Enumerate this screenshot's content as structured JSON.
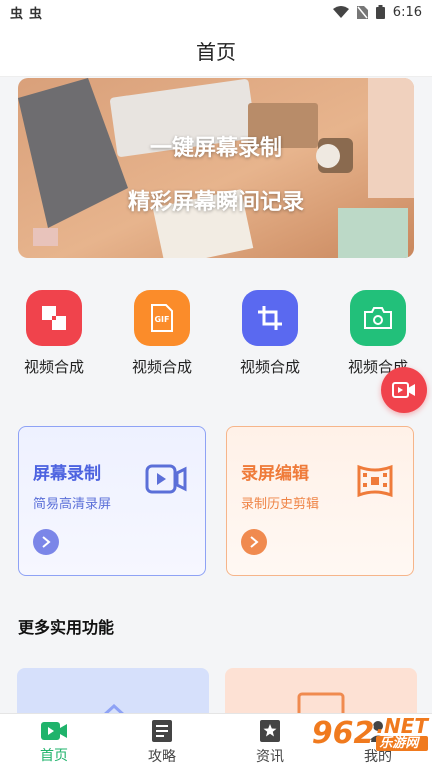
{
  "status": {
    "left_icons": [
      "虫",
      "虫"
    ],
    "time": "6:16"
  },
  "header": {
    "title": "首页"
  },
  "banner": {
    "line1": "一键屏幕录制",
    "line2": "精彩屏幕瞬间记录"
  },
  "tools": [
    {
      "label": "视频合成",
      "color": "#f0434c",
      "icon": "crop-merge-icon"
    },
    {
      "label": "视频合成",
      "color": "#fb8c2a",
      "icon": "gif-icon"
    },
    {
      "label": "视频合成",
      "color": "#5a69f0",
      "icon": "crop-icon"
    },
    {
      "label": "视频合成",
      "color": "#22c07a",
      "icon": "camera-rotate-icon"
    }
  ],
  "cards": [
    {
      "title": "屏幕录制",
      "subtitle": "简易高清录屏",
      "accent": "#5b6fd8"
    },
    {
      "title": "录屏编辑",
      "subtitle": "录制历史剪辑",
      "accent": "#ef7b3a"
    }
  ],
  "section": {
    "title": "更多实用功能"
  },
  "tabs": [
    {
      "label": "首页",
      "icon": "home-video-icon",
      "active": true
    },
    {
      "label": "攻略",
      "icon": "document-icon",
      "active": false
    },
    {
      "label": "资讯",
      "icon": "bookmark-star-icon",
      "active": false
    },
    {
      "label": "我的",
      "icon": "person-icon",
      "active": false
    }
  ],
  "watermark": {
    "brand": "962",
    "net": ".NET",
    "site": "乐游网"
  }
}
